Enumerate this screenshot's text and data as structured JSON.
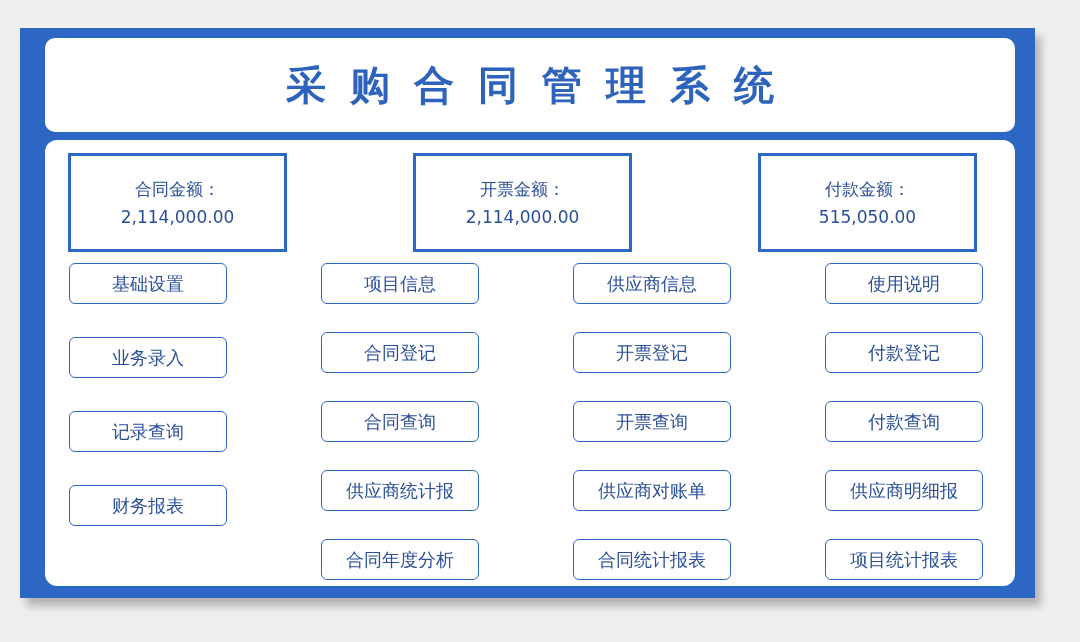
{
  "title": "采购合同管理系统",
  "summary": [
    {
      "label": "合同金额：",
      "value": "2,114,000.00"
    },
    {
      "label": "开票金额：",
      "value": "2,114,000.00"
    },
    {
      "label": "付款金额：",
      "value": "515,050.00"
    }
  ],
  "menu_columns": [
    {
      "buttons": [
        "基础设置",
        "业务录入",
        "记录查询",
        "财务报表"
      ]
    },
    {
      "buttons": [
        "项目信息",
        "合同登记",
        "合同查询",
        "供应商统计报",
        "合同年度分析"
      ]
    },
    {
      "buttons": [
        "供应商信息",
        "开票登记",
        "开票查询",
        "供应商对账单",
        "合同统计报表"
      ]
    },
    {
      "buttons": [
        "使用说明",
        "付款登记",
        "付款查询",
        "供应商明细报",
        "项目统计报表"
      ]
    }
  ]
}
